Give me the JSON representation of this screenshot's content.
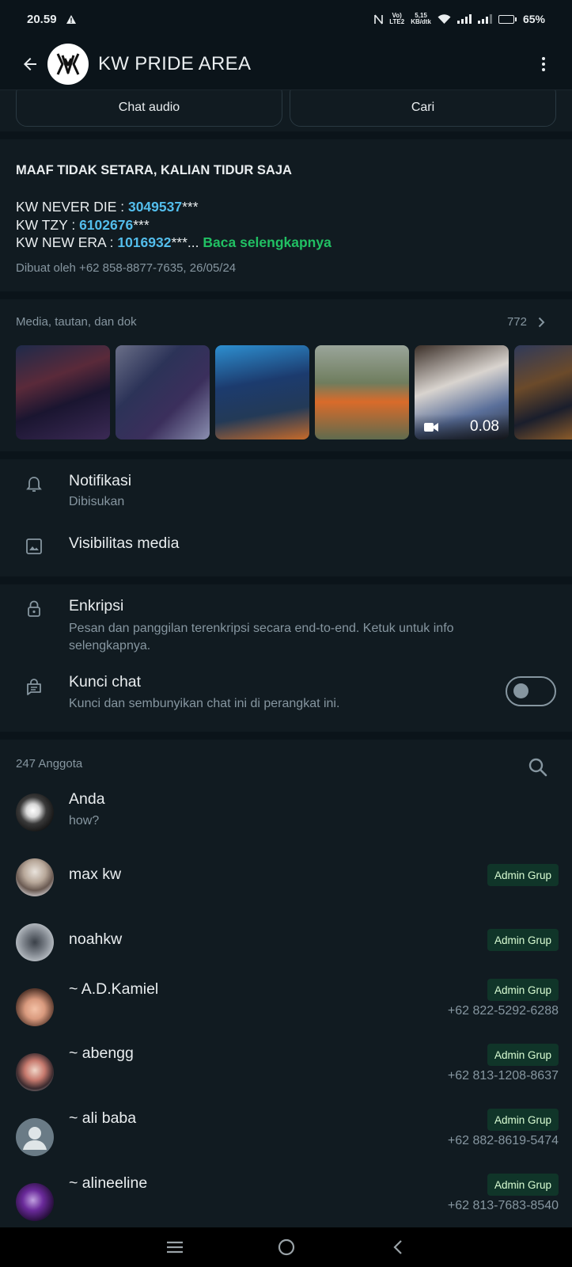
{
  "status_bar": {
    "time": "20.59",
    "volte": "Vo)\nLTE2",
    "speed": "5,15\nKB/dtk",
    "battery": "65%",
    "battery_level": 0.65
  },
  "app_bar": {
    "title": "KW PRIDE AREA",
    "back_icon": "arrow-left-icon",
    "menu_icon": "more-vertical-icon"
  },
  "actions": {
    "audio_label": "Chat audio",
    "search_label": "Cari"
  },
  "description": {
    "title": "MAAF TIDAK SETARA, KALIAN TIDUR SAJA",
    "lines": [
      {
        "prefix": "KW NEVER DIE : ",
        "number": "3049537",
        "suffix": "***"
      },
      {
        "prefix": "KW TZY : ",
        "number": "6102676",
        "suffix": "***"
      },
      {
        "prefix": "KW NEW ERA : ",
        "number": "1016932",
        "suffix": "***... "
      }
    ],
    "read_more": "Baca selengkapnya",
    "meta": "Dibuat oleh +62 858-8877-7635, 26/05/24"
  },
  "media": {
    "heading": "Media, tautan, dan dok",
    "count": "772",
    "video_duration": "0.08"
  },
  "settings": {
    "notifications_title": "Notifikasi",
    "notifications_sub": "Dibisukan",
    "media_visibility_title": "Visibilitas media",
    "encryption_title": "Enkripsi",
    "encryption_sub": "Pesan dan panggilan terenkripsi secara end-to-end. Ketuk untuk info selengkapnya.",
    "chat_lock_title": "Kunci chat",
    "chat_lock_sub": "Kunci dan sembunyikan chat ini di perangkat ini.",
    "chat_lock_enabled": false
  },
  "members": {
    "heading": "247 Anggota",
    "admin_label": "Admin Grup",
    "list": [
      {
        "name": "Anda",
        "sub": "how?",
        "admin": false,
        "phone": ""
      },
      {
        "name": "max kw",
        "sub": "",
        "admin": true,
        "phone": ""
      },
      {
        "name": "noahkw",
        "sub": "",
        "admin": true,
        "phone": ""
      },
      {
        "name": "~ A.D.Kamiel",
        "sub": "",
        "admin": true,
        "phone": "+62 822-5292-6288"
      },
      {
        "name": "~ abengg",
        "sub": "",
        "admin": true,
        "phone": "+62 813-1208-8637"
      },
      {
        "name": "~ ali baba",
        "sub": "",
        "admin": true,
        "phone": "+62 882-8619-5474"
      },
      {
        "name": "~ alineeline",
        "sub": "",
        "admin": true,
        "phone": "+62 813-7683-8540"
      }
    ]
  },
  "colors": {
    "background": "#0b141a",
    "panel": "#111b21",
    "accent_green": "#21c063",
    "link_blue": "#53bdeb",
    "badge_bg": "#103529"
  }
}
